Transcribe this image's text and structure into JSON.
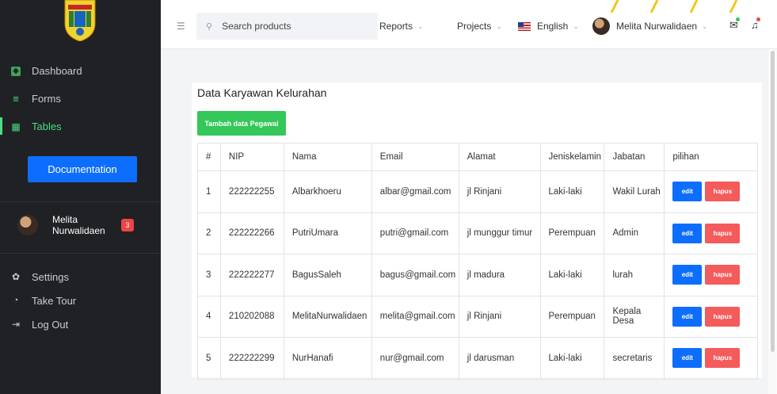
{
  "sidebar": {
    "items": [
      {
        "label": "Dashboard",
        "icon": "dashboard-icon"
      },
      {
        "label": "Forms",
        "icon": "forms-icon"
      },
      {
        "label": "Tables",
        "icon": "tables-icon",
        "active": true
      }
    ],
    "documentation_label": "Documentation",
    "user": {
      "name_line1": "Melita",
      "name_line2": "Nurwalidaen",
      "badge_count": "3"
    },
    "bottom_items": [
      {
        "label": "Settings",
        "icon": "gear-icon"
      },
      {
        "label": "Take Tour",
        "icon": "tour-icon"
      },
      {
        "label": "Log Out",
        "icon": "logout-icon"
      }
    ],
    "accent_color": "#4ade80"
  },
  "topbar": {
    "search_placeholder": "Search products",
    "reports_label": "Reports",
    "projects_label": "Projects",
    "language_label": "English",
    "user_name": "Melita Nurwalidaen"
  },
  "card": {
    "title": "Data Karyawan Kelurahan",
    "add_button_label": "Tambah data Pegawai",
    "columns": [
      "#",
      "NIP",
      "Nama",
      "Email",
      "Alamat",
      "Jeniskelamin",
      "Jabatan",
      "pilihan"
    ],
    "rows": [
      [
        "1",
        "222222255",
        "Albarkhoeru",
        "albar@gmail.com",
        "jl Rinjani",
        "Laki-laki",
        "Wakil Lurah"
      ],
      [
        "2",
        "222222266",
        "PutriUmara",
        "putri@gmail.com",
        "jl munggur timur",
        "Perempuan",
        "Admin"
      ],
      [
        "3",
        "222222277",
        "BagusSaleh",
        "bagus@gmail.com",
        "jl madura",
        "Laki-laki",
        "lurah"
      ],
      [
        "4",
        "210202088",
        "MelitaNurwalidaen",
        "melita@gmail.com",
        "jl Rinjani",
        "Perempuan",
        "Kepala Desa"
      ],
      [
        "5",
        "222222299",
        "NurHanafi",
        "nur@gmail.com",
        "jl darusman",
        "Laki-laki",
        "secretaris"
      ]
    ],
    "edit_label": "edit",
    "delete_label": "hapus"
  },
  "colors": {
    "primary": "#0d6efd",
    "success": "#34c759",
    "danger": "#f45b5b"
  }
}
